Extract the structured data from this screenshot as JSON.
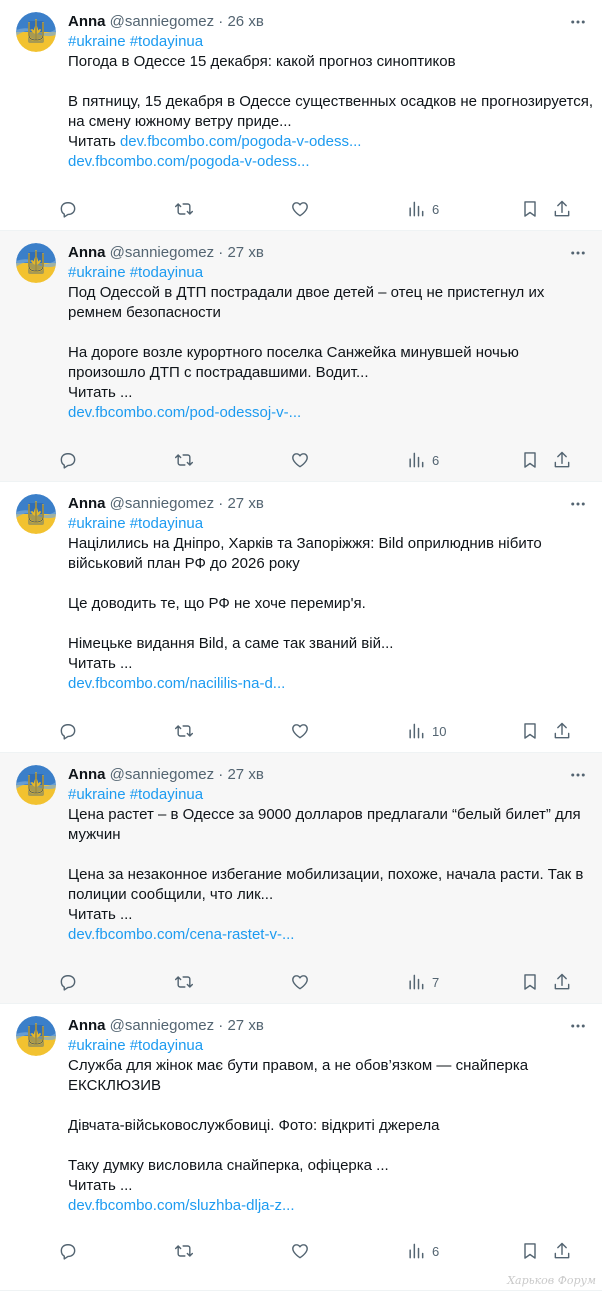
{
  "tweets": [
    {
      "author": "Anna",
      "handle": "@sanniegomez",
      "dot": "·",
      "time": "26 хв",
      "lines": [
        {
          "t": "tags",
          "v": "#ukraine #todayinua"
        },
        {
          "t": "text",
          "v": "Погода в Одессе 15 декабря: какой прогноз синоптиков"
        },
        {
          "t": "blank",
          "v": ""
        },
        {
          "t": "text",
          "v": "В пятницу, 15 декабря в Одессе существенных осадков не прогнозируется,"
        },
        {
          "t": "text",
          "v": "на смену южному ветру приде..."
        },
        {
          "t": "mixed",
          "v": " Читать ",
          "link": "dev.fbcombo.com/pogoda-v-odess..."
        },
        {
          "t": "link",
          "v": "dev.fbcombo.com/pogoda-v-odess..."
        }
      ],
      "views": "6"
    },
    {
      "author": "Anna",
      "handle": "@sanniegomez",
      "dot": "·",
      "time": "27 хв",
      "lines": [
        {
          "t": "tags",
          "v": "#ukraine #todayinua"
        },
        {
          "t": "text",
          "v": "Под Одессой в ДТП пострадали двое детей – отец не пристегнул их"
        },
        {
          "t": "text",
          "v": "ремнем безопасности"
        },
        {
          "t": "blank",
          "v": ""
        },
        {
          "t": "text",
          "v": "На дороге возле курортного поселка Санжейка минувшей ночью"
        },
        {
          "t": "text",
          "v": "произошло ДТП с пострадавшими. Водит..."
        },
        {
          "t": "text",
          "v": " Читать ..."
        },
        {
          "t": "link",
          "v": "dev.fbcombo.com/pod-odessoj-v-..."
        }
      ],
      "views": "6"
    },
    {
      "author": "Anna",
      "handle": "@sanniegomez",
      "dot": "·",
      "time": "27 хв",
      "lines": [
        {
          "t": "tags",
          "v": "#ukraine #todayinua"
        },
        {
          "t": "text",
          "v": "Націлились на Дніпро, Харків та Запоріжжя: Bild оприлюднив нібито"
        },
        {
          "t": "text",
          "v": "військовий план РФ до 2026 року"
        },
        {
          "t": "blank",
          "v": ""
        },
        {
          "t": "text",
          "v": "Це доводить те, що РФ не хоче перемир'я."
        },
        {
          "t": "blank",
          "v": ""
        },
        {
          "t": "text",
          "v": "Німецьке видання Bild, а саме так званий вій..."
        },
        {
          "t": "text",
          "v": " Читать ..."
        },
        {
          "t": "link",
          "v": "dev.fbcombo.com/nacililis-na-d..."
        }
      ],
      "views": "10"
    },
    {
      "author": "Anna",
      "handle": "@sanniegomez",
      "dot": "·",
      "time": "27 хв",
      "lines": [
        {
          "t": "tags",
          "v": "#ukraine #todayinua"
        },
        {
          "t": "text",
          "v": "Цена растет – в Одессе за 9000 долларов предлагали “белый билет” для"
        },
        {
          "t": "text",
          "v": "мужчин"
        },
        {
          "t": "blank",
          "v": ""
        },
        {
          "t": "text",
          "v": "Цена за незаконное избегание мобилизации, похоже, начала расти. Так в"
        },
        {
          "t": "text",
          "v": "полиции сообщили, что лик..."
        },
        {
          "t": "text",
          "v": " Читать ..."
        },
        {
          "t": "link",
          "v": "dev.fbcombo.com/cena-rastet-v-..."
        }
      ],
      "views": "7"
    },
    {
      "author": "Anna",
      "handle": "@sanniegomez",
      "dot": "·",
      "time": "27 хв",
      "lines": [
        {
          "t": "tags",
          "v": "#ukraine #todayinua"
        },
        {
          "t": "text",
          "v": "Служба для жінок має бути правом, а не обов’язком — снайперка"
        },
        {
          "t": "text",
          "v": "ЕКСКЛЮЗИВ"
        },
        {
          "t": "blank",
          "v": ""
        },
        {
          "t": "text",
          "v": "Дівчата-військовослужбовиці. Фото: відкриті джерела"
        },
        {
          "t": "blank",
          "v": ""
        },
        {
          "t": "text",
          "v": "Таку думку висловила снайперка, офіцерка ..."
        },
        {
          "t": "text",
          "v": " Читать ..."
        },
        {
          "t": "link",
          "v": "dev.fbcombo.com/sluzhba-dlja-z..."
        }
      ],
      "views": "6"
    }
  ],
  "colors": {
    "link": "#1d9bf0",
    "muted": "#536471",
    "text": "#0f1419",
    "flag_blue": "#0057b8",
    "flag_yellow": "#ffd700"
  },
  "icons": {
    "reply": "reply-icon",
    "retweet": "retweet-icon",
    "like": "heart-icon",
    "views": "views-icon",
    "bookmark": "bookmark-icon",
    "share": "share-icon",
    "more": "more-icon",
    "avatar": "trident-avatar"
  },
  "watermark": "Харьков Форум"
}
